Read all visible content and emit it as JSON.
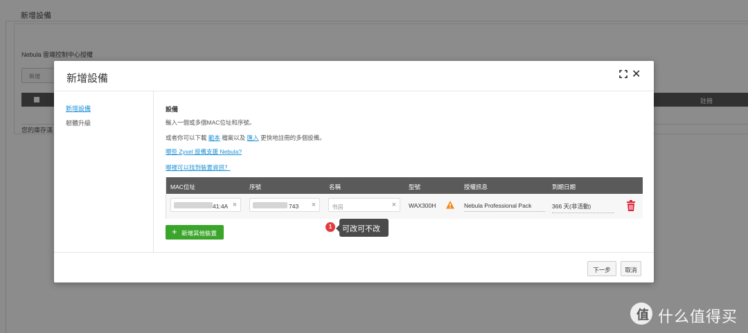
{
  "background": {
    "breadcrumb": [
      "",
      "",
      ""
    ],
    "title": "新增設備",
    "subtitle": "Nebula 雲端控制中心授權",
    "add_button": "新增",
    "table_header_note": "註冊",
    "footer_note": "您的庫存滿"
  },
  "modal": {
    "title": "新增設備",
    "nav": [
      "新增設備",
      "韌體升級"
    ],
    "heading": "設備",
    "line1": "輸入一個或多個MAC位址和序號。",
    "line2_prefix": "或者你可以下載",
    "line2_link1": "範本",
    "line2_mid": "檔案以及",
    "line2_link2": "匯入",
    "line2_suffix": "更快地註冊的多個設備。",
    "link_support": "哪些 Zyxel 設備支援 Nebula?",
    "link_info": "哪裡可以找到裝置資訊？",
    "table": {
      "columns": [
        "MAC位址",
        "序號",
        "名稱",
        "型號",
        "授權訊息",
        "到期日期"
      ],
      "row": {
        "mac_suffix": "41:4A",
        "serial_suffix": "743",
        "name_placeholder": "书房",
        "model": "WAX300H",
        "license": "Nebula Professional Pack",
        "expiry": "366 天(非活動)"
      }
    },
    "add_device_label": "新增其他裝置",
    "next_label": "下一步",
    "cancel_label": "取消"
  },
  "annotation": {
    "badge": "1",
    "tip": "可改可不改"
  },
  "watermark": {
    "logo": "值",
    "text": "什么值得买"
  },
  "colors": {
    "accent_green": "#3aa52a",
    "link_blue": "#1a8fd6",
    "warning_orange": "#f28a1c",
    "delete_red": "#d9253b"
  }
}
